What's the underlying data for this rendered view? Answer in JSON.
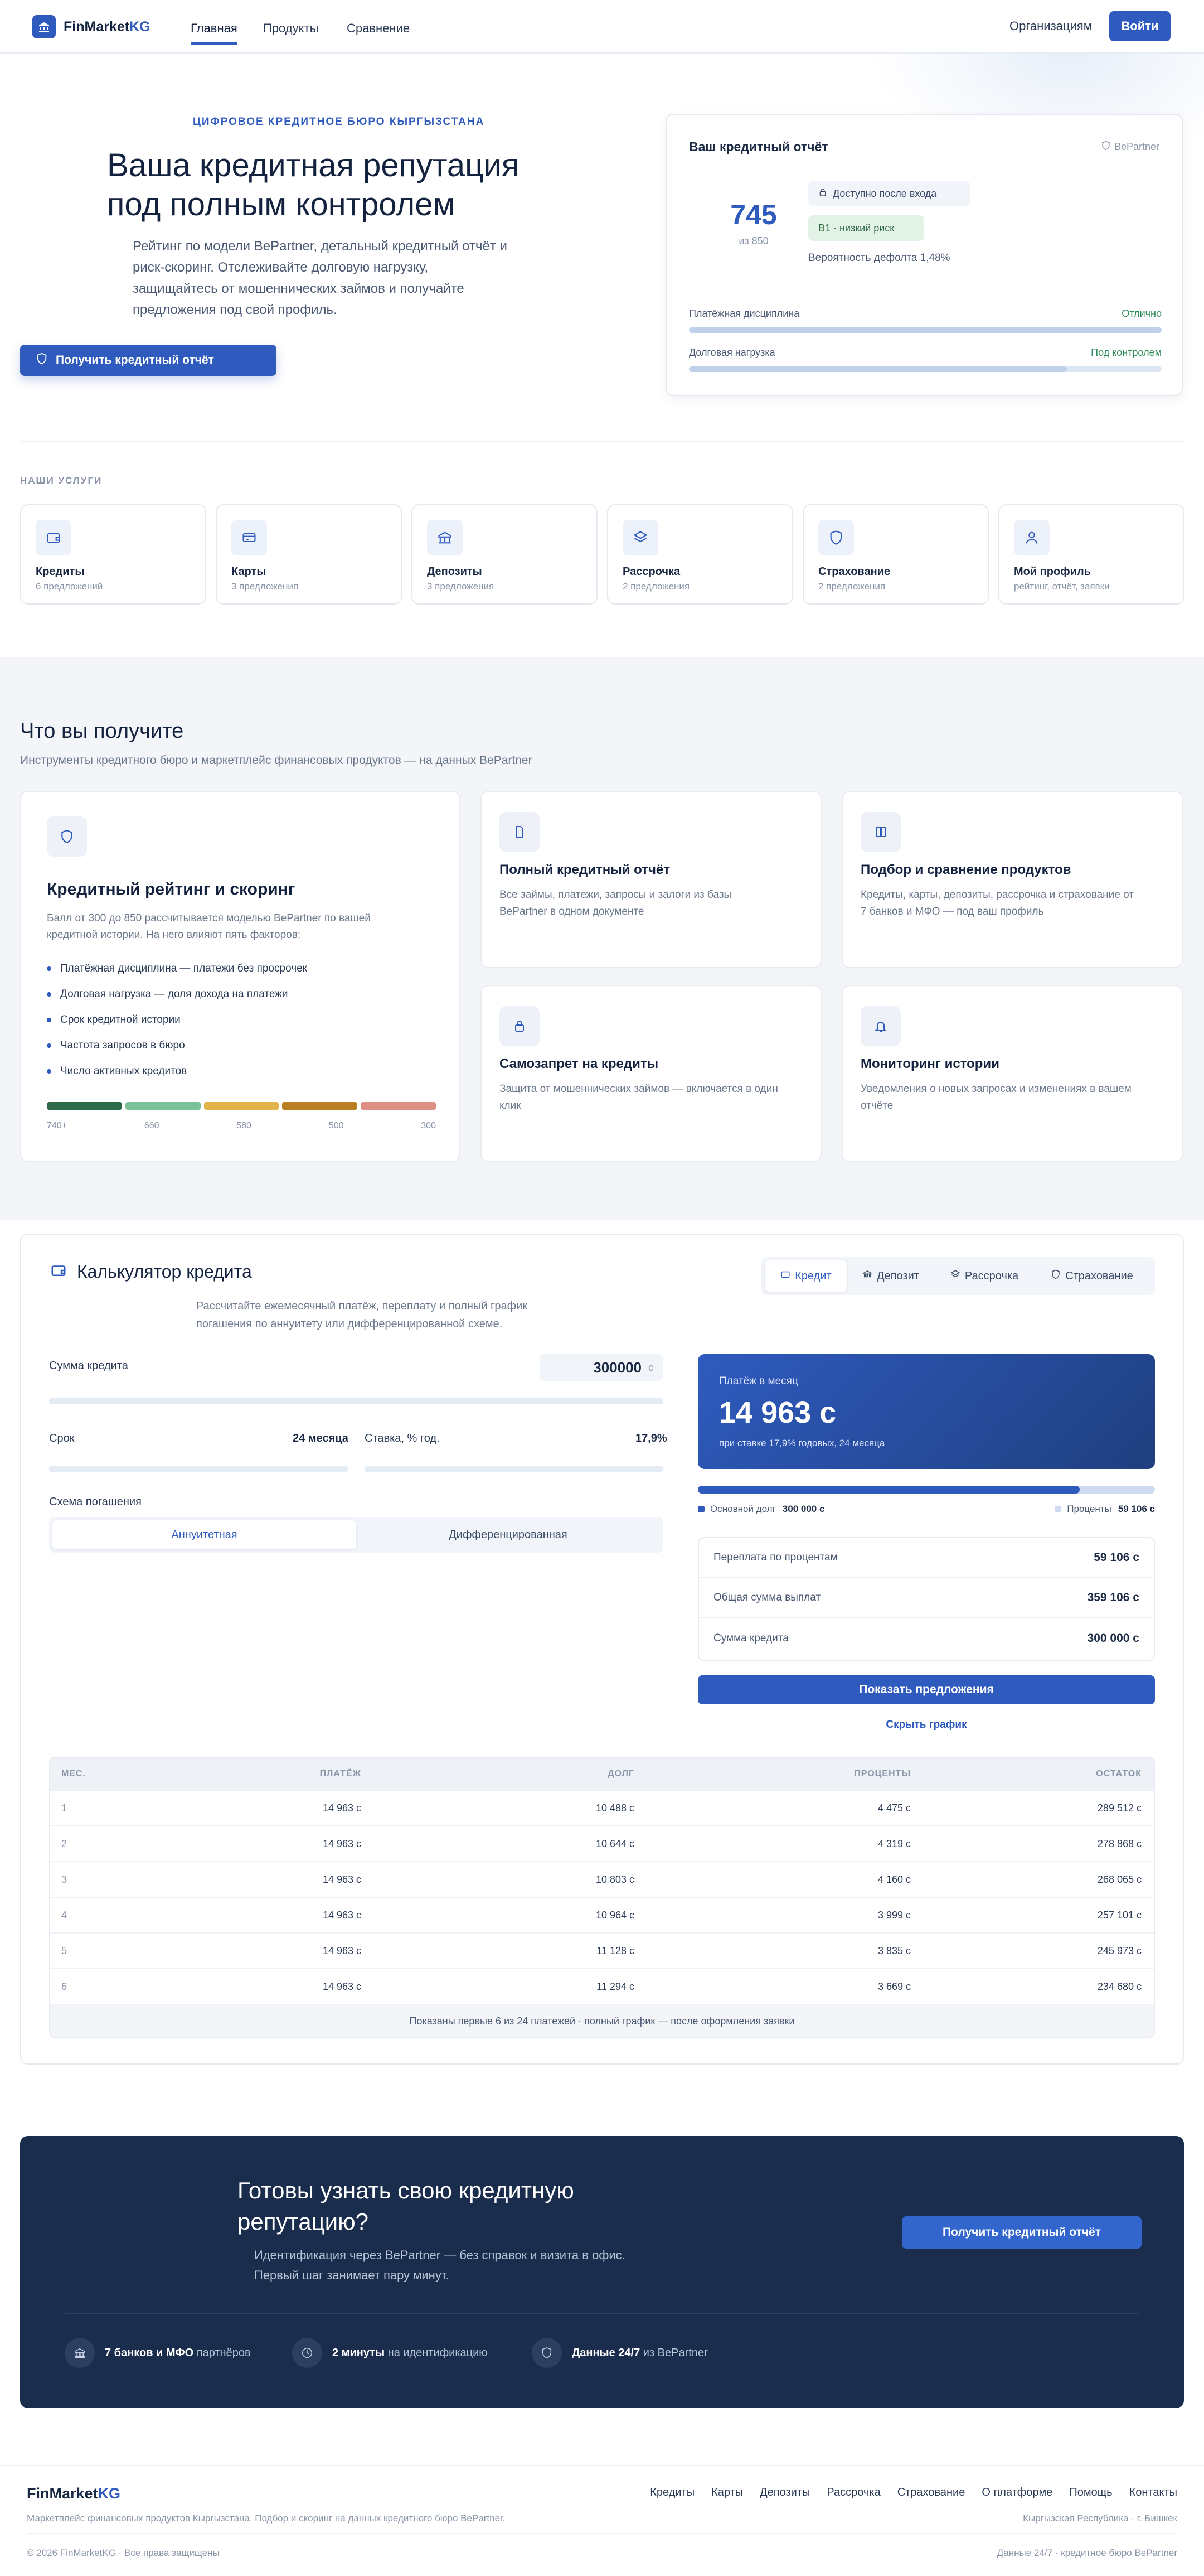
{
  "header": {
    "brand_first": "FinMarket",
    "brand_second": "KG",
    "nav": [
      "Главная",
      "Продукты",
      "Сравнение"
    ],
    "orgs": "Организациям",
    "login": "Войти"
  },
  "hero": {
    "eyebrow": "ЦИФРОВОЕ КРЕДИТНОЕ БЮРО КЫРГЫЗСТАНА",
    "title_l1": "Ваша кредитная репутация",
    "title_l2": "под полным контролем",
    "lead_l1": "Рейтинг по модели BePartner, детальный кредитный отчёт и",
    "lead_l2": "риск-скоринг. Отслеживайте долговую нагрузку,",
    "lead_l3": "защищайтесь от мошеннических займов и получайте",
    "lead_l4": "предложения под свой профиль.",
    "cta": "Получить кредитный отчёт"
  },
  "report": {
    "title": "Ваш кредитный отчёт",
    "partner": "BePartner",
    "score": "745",
    "score_of": "из 850",
    "locked": "Доступно после входа",
    "risk": "B1 · низкий риск",
    "pd": "Вероятность дефолта 1,48%",
    "m1_label": "Платёжная дисциплина",
    "m1_value": "Отлично",
    "m1_fill": 1.0,
    "m2_label": "Долговая нагрузка",
    "m2_value": "Под контролем",
    "m2_fill": 0.8
  },
  "services": {
    "title": "НАШИ УСЛУГИ",
    "items": [
      {
        "title": "Кредиты",
        "sub": "6 предложений",
        "icon": "wallet-icon"
      },
      {
        "title": "Карты",
        "sub": "3 предложения",
        "icon": "card-icon"
      },
      {
        "title": "Депозиты",
        "sub": "3 предложения",
        "icon": "bank-icon"
      },
      {
        "title": "Рассрочка",
        "sub": "2 предложения",
        "icon": "layers-icon"
      },
      {
        "title": "Страхование",
        "sub": "2 предложения",
        "icon": "shield-icon"
      },
      {
        "title": "Мой профиль",
        "sub": "рейтинг, отчёт, заявки",
        "icon": "user-icon"
      }
    ]
  },
  "features": {
    "title": "Что вы получите",
    "subtitle": "Инструменты кредитного бюро и маркетплейс финансовых продуктов — на данных BePartner",
    "main_title": "Кредитный рейтинг и скоринг",
    "main_desc_l1": "Балл от 300 до 850 рассчитывается моделью BePartner по вашей",
    "main_desc_l2": "кредитной истории. На него влияют пять факторов:",
    "factors": [
      "Платёжная дисциплина — платежи без просрочек",
      "Долговая нагрузка — доля дохода на платежи",
      "Срок кредитной истории",
      "Частота запросов в бюро",
      "Число активных кредитов"
    ],
    "scale": [
      "740+",
      "660",
      "580",
      "500",
      "300"
    ],
    "cards": [
      {
        "title": "Полный кредитный отчёт",
        "d1": "Все займы, платежи, запросы и залоги из базы",
        "d2": "BePartner в одном документе",
        "icon": "document-icon"
      },
      {
        "title": "Подбор и сравнение продуктов",
        "d1": "Кредиты, карты, депозиты, рассрочка и страхование от",
        "d2": "7 банков и МФО — под ваш профиль",
        "icon": "columns-icon"
      },
      {
        "title": "Самозапрет на кредиты",
        "d1": "Защита от мошеннических займов — включается в один",
        "d2": "клик",
        "icon": "lock-icon"
      },
      {
        "title": "Мониторинг истории",
        "d1": "Уведомления о новых запросах и изменениях в вашем",
        "d2": "отчёте",
        "icon": "bell-icon"
      }
    ]
  },
  "calc": {
    "title": "Калькулятор кредита",
    "desc_l1": "Рассчитайте ежемесячный платёж, переплату и полный график",
    "desc_l2": "погашения по аннуитету или дифференцированной схеме.",
    "tabs": [
      "Кредит",
      "Депозит",
      "Рассрочка",
      "Страхование"
    ],
    "amount_label": "Сумма кредита",
    "amount_value": "300000",
    "amount_unit": "с",
    "term_label": "Срок",
    "term_value": "24 месяца",
    "rate_label": "Ставка, % год.",
    "rate_value": "17,9%",
    "scheme_label": "Схема погашения",
    "scheme": [
      "Аннуитетная",
      "Дифференцированная"
    ],
    "pay_label": "Платёж в месяц",
    "pay_value": "14 963 с",
    "pay_note": "при ставке 17,9% годовых, 24 месяца",
    "principal_share": 0.835,
    "principal_label": "Основной долг",
    "principal_value": "300 000 с",
    "interest_label": "Проценты",
    "interest_value": "59 106 с",
    "rows": [
      {
        "label": "Переплата по процентам",
        "value": "59 106 с"
      },
      {
        "label": "Общая сумма выплат",
        "value": "359 106 с"
      },
      {
        "label": "Сумма кредита",
        "value": "300 000 с"
      }
    ],
    "show_offers": "Показать предложения",
    "hide_schedule": "Скрыть график",
    "table_head": [
      "МЕС.",
      "ПЛАТЁЖ",
      "ДОЛГ",
      "ПРОЦЕНТЫ",
      "ОСТАТОК"
    ],
    "table_rows": [
      [
        "1",
        "14 963 с",
        "10 488 с",
        "4 475 с",
        "289 512 с"
      ],
      [
        "2",
        "14 963 с",
        "10 644 с",
        "4 319 с",
        "278 868 с"
      ],
      [
        "3",
        "14 963 с",
        "10 803 с",
        "4 160 с",
        "268 065 с"
      ],
      [
        "4",
        "14 963 с",
        "10 964 с",
        "3 999 с",
        "257 101 с"
      ],
      [
        "5",
        "14 963 с",
        "11 128 с",
        "3 835 с",
        "245 973 с"
      ],
      [
        "6",
        "14 963 с",
        "11 294 с",
        "3 669 с",
        "234 680 с"
      ]
    ],
    "table_note": "Показаны первые 6 из 24 платежей · полный график — после оформления заявки"
  },
  "cta": {
    "title_l1": "Готовы узнать свою кредитную",
    "title_l2": "репутацию?",
    "desc_l1": "Идентификация через BePartner — без справок и визита в офис.",
    "desc_l2": "Первый шаг занимает пару минут.",
    "button": "Получить кредитный отчёт",
    "stats": [
      {
        "bold": "7 банков и МФО",
        "rest": " партнёров",
        "icon": "bank-icon"
      },
      {
        "bold": "2 минуты",
        "rest": " на идентификацию",
        "icon": "clock-icon"
      },
      {
        "bold": "Данные 24/7",
        "rest": " из BePartner",
        "icon": "shield-icon"
      }
    ]
  },
  "footer": {
    "brand_first": "FinMarket",
    "brand_second": "KG",
    "links": [
      "Кредиты",
      "Карты",
      "Депозиты",
      "Рассрочка",
      "Страхование",
      "О платформе",
      "Помощь",
      "Контакты"
    ],
    "tagline": "Маркетплейс финансовых продуктов Кыргызстана. Подбор и скоринг на данных кредитного бюро BePartner.",
    "location": "Кыргызская Республика · г. Бишкек",
    "copyright": "© 2026 FinMarketKG · Все права защищены",
    "data_note": "Данные 24/7 · кредитное бюро BePartner"
  },
  "colors": {
    "accent": "#2f5bbf",
    "navy": "#1b2d4d",
    "success": "#2e8b57"
  }
}
